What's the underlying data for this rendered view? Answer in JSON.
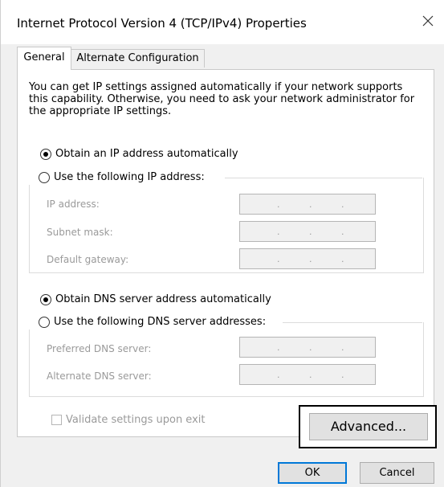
{
  "window": {
    "title": "Internet Protocol Version 4 (TCP/IPv4) Properties"
  },
  "tabs": [
    {
      "label": "General",
      "active": true
    },
    {
      "label": "Alternate Configuration",
      "active": false
    }
  ],
  "general": {
    "intro": "You can get IP settings assigned automatically if your network supports this capability. Otherwise, you need to ask your network administrator for the appropriate IP settings.",
    "ip_auto_label": "Obtain an IP address automatically",
    "ip_manual_label": "Use the following IP address:",
    "ip_fields": [
      {
        "label": "IP address:",
        "value": ""
      },
      {
        "label": "Subnet mask:",
        "value": ""
      },
      {
        "label": "Default gateway:",
        "value": ""
      }
    ],
    "dns_auto_label": "Obtain DNS server address automatically",
    "dns_manual_label": "Use the following DNS server addresses:",
    "dns_fields": [
      {
        "label": "Preferred DNS server:",
        "value": ""
      },
      {
        "label": "Alternate DNS server:",
        "value": ""
      }
    ],
    "validate_label": "Validate settings upon exit",
    "advanced_label": "Advanced..."
  },
  "footer": {
    "ok_label": "OK",
    "cancel_label": "Cancel"
  },
  "state": {
    "ip_mode": "auto",
    "dns_mode": "auto",
    "validate_checked": false
  },
  "icons": {
    "close": "close-icon"
  },
  "colors": {
    "panel_bg": "#ffffff",
    "window_bg": "#f0f0f0",
    "disabled_text": "#9a9a9a",
    "ok_border": "#0078d7"
  }
}
